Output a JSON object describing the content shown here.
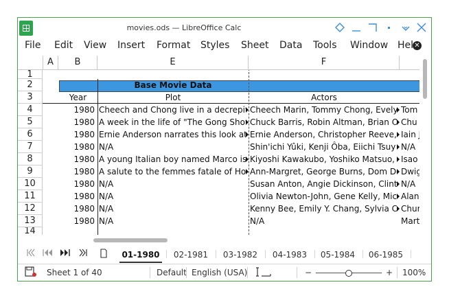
{
  "window": {
    "title": "movies.ods — LibreOffice Calc",
    "accent_color": "#3f8fd0",
    "controls": [
      "diamond-icon",
      "minimize-icon",
      "maximize-icon",
      "dot-icon",
      "chevron-down-icon",
      "close-icon"
    ]
  },
  "menubar": {
    "items": [
      "File",
      "Edit",
      "View",
      "Insert",
      "Format",
      "Styles",
      "Sheet",
      "Data",
      "Tools",
      "Window",
      "Hel"
    ]
  },
  "columns": [
    "A",
    "B",
    "E",
    "F"
  ],
  "rows": [
    "1",
    "2",
    "3",
    "4",
    "5",
    "6",
    "7",
    "8",
    "9",
    "10",
    "11",
    "12",
    "13",
    "14"
  ],
  "sheet": {
    "banner": "Base Movie Data",
    "banner_color": "#3d97e0",
    "headers": {
      "year": "Year",
      "plot": "Plot",
      "actors": "Actors"
    },
    "records": [
      {
        "year": "1980",
        "plot": "Cheech and Chong live in a decrepit",
        "actors": "Cheech Marin, Tommy Chong, Evely",
        "next": "Tom"
      },
      {
        "year": "1980",
        "plot": "A week in the life of \"The Gong Show",
        "actors": "Chuck Barris, Robin Altman, Brian O'",
        "next": "Chu"
      },
      {
        "year": "1980",
        "plot": "Ernie Anderson narrates this look at th",
        "actors": "Ernie Anderson, Christopher Reeve, R",
        "next": "Iain J"
      },
      {
        "year": "1980",
        "plot": "N/A",
        "actors": "Shin'ichi Yûki, Kenji Ôba, Eiichi Tsuy",
        "next": "N/A"
      },
      {
        "year": "1980",
        "plot": "A young Italian boy named Marco is e",
        "actors": "Kiyoshi Kawakubo, Yoshiko Matsuo, K",
        "next": "Isao"
      },
      {
        "year": "1980",
        "plot": "A salute to the femmes fatale of Holly",
        "actors": "Ann-Margret, George Burns, Dom De",
        "next": "Dwig"
      },
      {
        "year": "1980",
        "plot": "N/A",
        "actors": "Susan Anton, Angie Dickinson, Clint",
        "next": "N/A"
      },
      {
        "year": "1980",
        "plot": "N/A",
        "actors": "Olivia Newton-John, Gene Kelly, Mich",
        "next": "Alan"
      },
      {
        "year": "1980",
        "plot": "N/A",
        "actors": "Kenny Bee, Emily Y. Chang, Sylvia C",
        "next": "Chur"
      },
      {
        "year": "1980",
        "plot": "N/A",
        "actors": "N/A",
        "next": "Mart"
      }
    ]
  },
  "tabs": {
    "nav": [
      "first-sheet-icon",
      "prev-sheet-icon",
      "next-sheet-icon",
      "last-sheet-icon",
      "add-sheet-icon"
    ],
    "sheets": [
      "01-1980",
      "02-1981",
      "03-1982",
      "04-1983",
      "05-1984",
      "06-1985"
    ],
    "active_index": 0
  },
  "statusbar": {
    "sheet_info": "Sheet 1 of 40",
    "page_style": "Default",
    "language": "English (USA)",
    "zoom_minus": "−",
    "zoom_plus": "+",
    "zoom": "100%",
    "zoom_level": 0.5
  }
}
